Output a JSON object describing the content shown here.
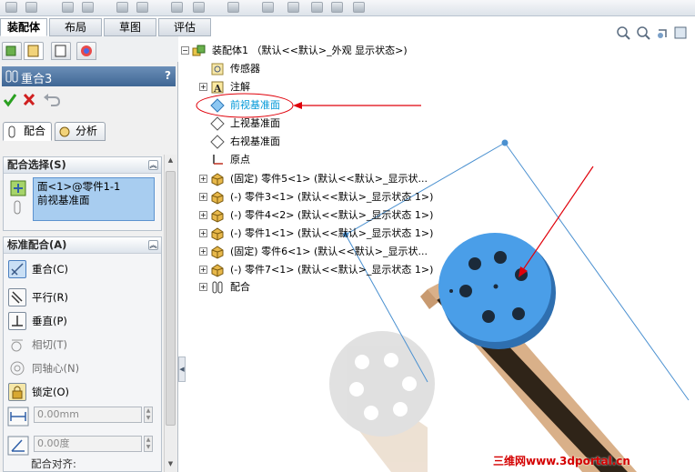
{
  "command_tabs": [
    {
      "label": "装配体"
    },
    {
      "label": "布局"
    },
    {
      "label": "草图"
    },
    {
      "label": "评估"
    }
  ],
  "property_manager": {
    "title": "重合3",
    "help": "?",
    "subtabs": [
      {
        "label": "配合"
      },
      {
        "label": "分析"
      }
    ],
    "mate_selection": {
      "header": "配合选择(S)",
      "items": [
        "面<1>@零件1-1",
        "前视基准面"
      ]
    },
    "standard_mates": {
      "header": "标准配合(A)",
      "items": [
        {
          "label": "重合(C)"
        },
        {
          "label": "平行(R)"
        },
        {
          "label": "垂直(P)"
        },
        {
          "label": "相切(T)"
        },
        {
          "label": "同轴心(N)"
        },
        {
          "label": "锁定(O)"
        }
      ],
      "distance_value": "0.00mm",
      "angle_value": "0.00度",
      "alignment_label": "配合对齐:"
    }
  },
  "feature_tree": {
    "nodes": [
      {
        "label": "装配体1 （默认<<默认>_外观 显示状态>)"
      },
      {
        "label": "传感器"
      },
      {
        "label": "注解"
      },
      {
        "label": "前视基准面"
      },
      {
        "label": "上视基准面"
      },
      {
        "label": "右视基准面"
      },
      {
        "label": "原点"
      },
      {
        "label": "(固定) 零件5<1> (默认<<默认>_显示状..."
      },
      {
        "label": "(-) 零件3<1> (默认<<默认>_显示状态 1>)"
      },
      {
        "label": "(-) 零件4<2> (默认<<默认>_显示状态 1>)"
      },
      {
        "label": "(-) 零件1<1> (默认<<默认>_显示状态 1>)"
      },
      {
        "label": "(固定) 零件6<1> (默认<<默认>_显示状..."
      },
      {
        "label": "(-) 零件7<1> (默认<<默认>_显示状态 1>)"
      },
      {
        "label": "配合"
      }
    ]
  },
  "watermark": "三维网www.3dportal.cn",
  "colors": {
    "selected_text": "#0098d8",
    "part_blue": "#4a9ee8",
    "arrow_red": "#e0000a",
    "title_bar": "#4a719e"
  }
}
